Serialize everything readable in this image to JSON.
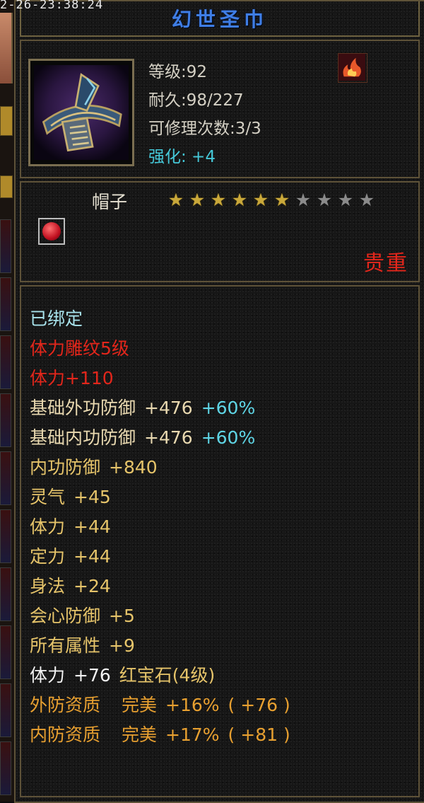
{
  "timestamp": "2-26-23:38:24",
  "item": {
    "name": "幻世圣巾",
    "level_label": "等级:92",
    "durability_label": "耐久:98/227",
    "repair_label": "可修理次数:3/3",
    "enhance_label": "强化: +4",
    "slot_type": "帽子",
    "stars_total": 10,
    "stars_filled": 6,
    "rarity": "贵重",
    "flame_icon": "flame-badge-icon",
    "gem_icon": "red-gem-icon"
  },
  "attributes": {
    "bound": "已绑定",
    "engrave": "体力雕纹5级",
    "engrave_bonus": "体力+110",
    "ext_def": {
      "label": "基础外功防御",
      "value": "+476",
      "pct": "+60%"
    },
    "int_def": {
      "label": "基础内功防御",
      "value": "+476",
      "pct": "+60%"
    },
    "neigong_def": {
      "label": "内功防御",
      "value": "+840"
    },
    "lingqi": {
      "label": "灵气",
      "value": "+45"
    },
    "tili": {
      "label": "体力",
      "value": "+44"
    },
    "dingli": {
      "label": "定力",
      "value": "+44"
    },
    "shenfa": {
      "label": "身法",
      "value": "+24"
    },
    "crit_def": {
      "label": "会心防御",
      "value": "+5"
    },
    "all_attr": {
      "label": "所有属性",
      "value": "+9"
    },
    "gem_line": {
      "label": "体力",
      "value": "+76",
      "gem": "红宝石(4级)"
    },
    "ext_quality": {
      "label": "外防资质",
      "grade": "完美",
      "pct": "+16%",
      "bonus": "( +76 )"
    },
    "int_quality": {
      "label": "内防资质",
      "grade": "完美",
      "pct": "+17%",
      "bonus": "( +81 )"
    }
  },
  "colors": {
    "title_blue": "#3f7ee6",
    "rarity_red": "#e3261b",
    "enhance_cyan": "#45c8d8",
    "star_gold": "#c9a83a",
    "attr_gold": "#e6c46a",
    "quality_orange": "#e8a030"
  }
}
